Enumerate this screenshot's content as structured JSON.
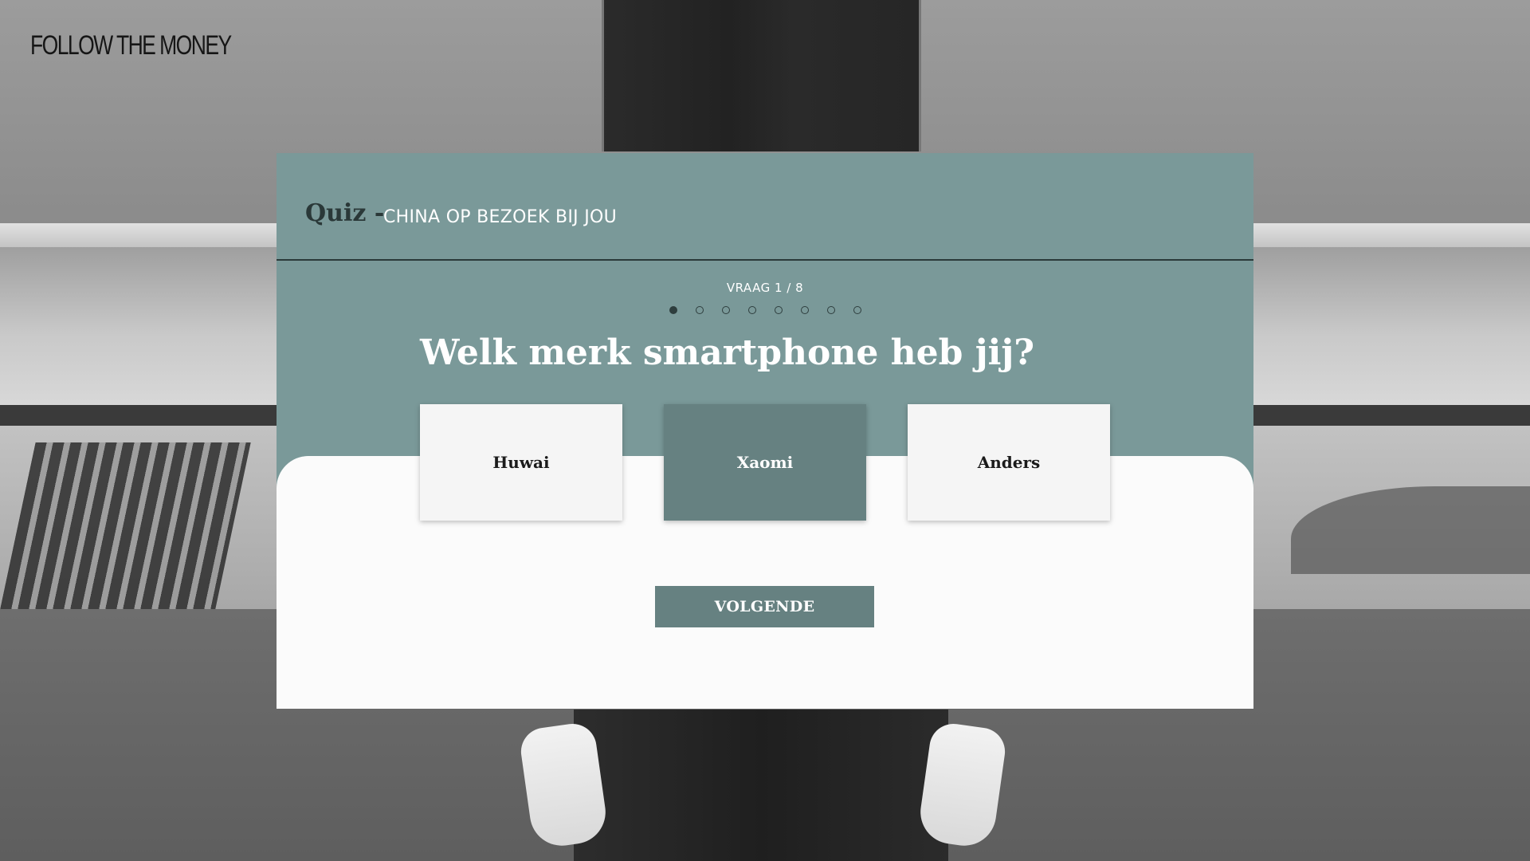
{
  "brand": {
    "logo_text": "FOLLOW THE MONEY"
  },
  "quiz": {
    "label": "Quiz -",
    "title": "CHINA OP BEZOEK BIJ JOU",
    "counter": "VRAAG 1 / 8",
    "current_question": 1,
    "total_questions": 8,
    "question": "Welk merk smartphone heb jij?",
    "answers": [
      {
        "label": "Huwai",
        "selected": false
      },
      {
        "label": "Xaomi",
        "selected": true
      },
      {
        "label": "Anders",
        "selected": false
      }
    ],
    "next_label": "VOLGENDE"
  },
  "colors": {
    "accent": "#7a9999",
    "button": "#668181",
    "panel": "#fbfbfb"
  }
}
